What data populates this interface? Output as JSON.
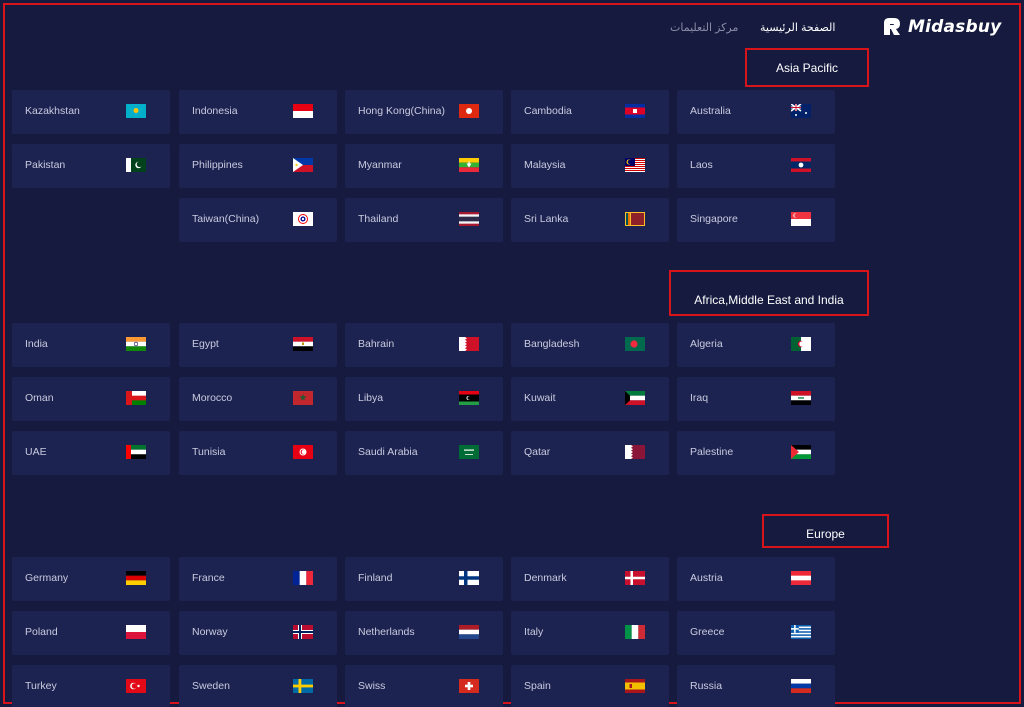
{
  "header": {
    "nav_help": "مركز التعليمات",
    "nav_home": "الصفحة الرئيسية",
    "logo_text": "Midasbuy"
  },
  "regions": [
    {
      "label": "Asia Pacific",
      "countries": [
        {
          "name": "Kazakhstan",
          "flag": "kz"
        },
        {
          "name": "Indonesia",
          "flag": "id"
        },
        {
          "name": "Hong Kong(China)",
          "flag": "hk"
        },
        {
          "name": "Cambodia",
          "flag": "kh"
        },
        {
          "name": "Australia",
          "flag": "au"
        },
        {
          "name": "Pakistan",
          "flag": "pk"
        },
        {
          "name": "Philippines",
          "flag": "ph"
        },
        {
          "name": "Myanmar",
          "flag": "mm"
        },
        {
          "name": "Malaysia",
          "flag": "my"
        },
        {
          "name": "Laos",
          "flag": "la"
        },
        {
          "name": "Taiwan(China)",
          "flag": "tw"
        },
        {
          "name": "Thailand",
          "flag": "th"
        },
        {
          "name": "Sri Lanka",
          "flag": "lk"
        },
        {
          "name": "Singapore",
          "flag": "sg"
        }
      ]
    },
    {
      "label": "Africa,Middle East and India",
      "countries": [
        {
          "name": "India",
          "flag": "in"
        },
        {
          "name": "Egypt",
          "flag": "eg"
        },
        {
          "name": "Bahrain",
          "flag": "bh"
        },
        {
          "name": "Bangladesh",
          "flag": "bd"
        },
        {
          "name": "Algeria",
          "flag": "dz"
        },
        {
          "name": "Oman",
          "flag": "om"
        },
        {
          "name": "Morocco",
          "flag": "ma"
        },
        {
          "name": "Libya",
          "flag": "ly"
        },
        {
          "name": "Kuwait",
          "flag": "kw"
        },
        {
          "name": "Iraq",
          "flag": "iq"
        },
        {
          "name": "UAE",
          "flag": "ae"
        },
        {
          "name": "Tunisia",
          "flag": "tn"
        },
        {
          "name": "Saudi Arabia",
          "flag": "sa"
        },
        {
          "name": "Qatar",
          "flag": "qa"
        },
        {
          "name": "Palestine",
          "flag": "ps"
        }
      ]
    },
    {
      "label": "Europe",
      "countries": [
        {
          "name": "Germany",
          "flag": "de"
        },
        {
          "name": "France",
          "flag": "fr"
        },
        {
          "name": "Finland",
          "flag": "fi"
        },
        {
          "name": "Denmark",
          "flag": "dk"
        },
        {
          "name": "Austria",
          "flag": "at"
        },
        {
          "name": "Poland",
          "flag": "pl"
        },
        {
          "name": "Norway",
          "flag": "no"
        },
        {
          "name": "Netherlands",
          "flag": "nl"
        },
        {
          "name": "Italy",
          "flag": "it"
        },
        {
          "name": "Greece",
          "flag": "gr"
        },
        {
          "name": "Turkey",
          "flag": "tr"
        },
        {
          "name": "Sweden",
          "flag": "se"
        },
        {
          "name": "Swiss",
          "flag": "ch"
        },
        {
          "name": "Spain",
          "flag": "es"
        },
        {
          "name": "Russia",
          "flag": "ru"
        }
      ]
    }
  ]
}
